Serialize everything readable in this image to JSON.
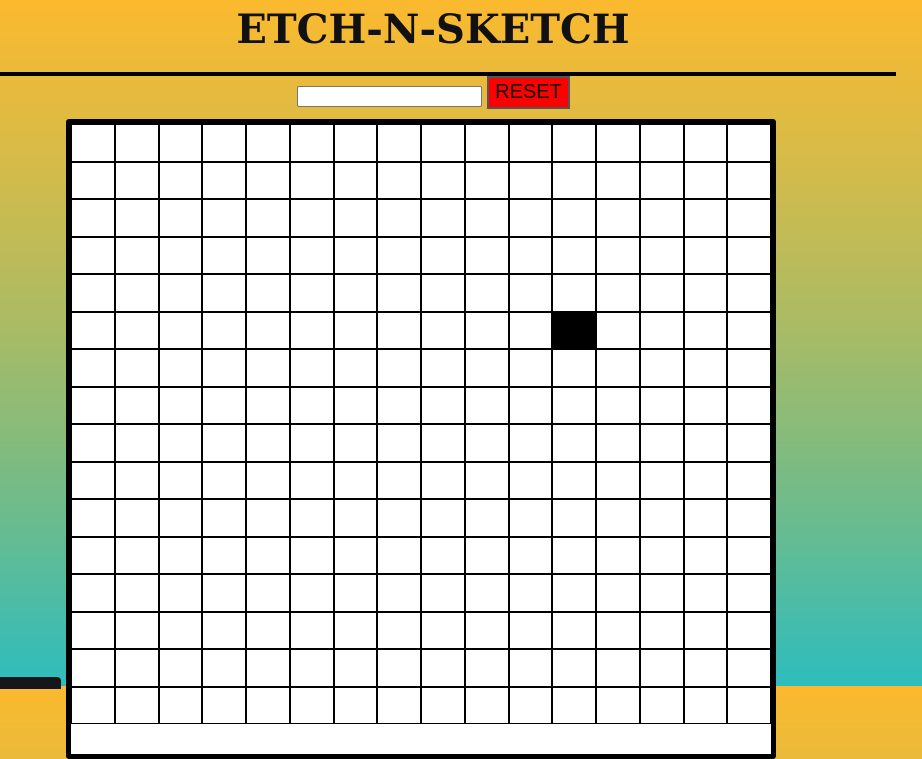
{
  "header": {
    "title": "ETCH-N-SKETCH"
  },
  "controls": {
    "size_input_value": "",
    "reset_label": "RESET",
    "reset_color": "#ff0000"
  },
  "board": {
    "columns": 16,
    "rows": 16,
    "ink_color": "#000000",
    "painted_cells": [
      {
        "row": 5,
        "col": 11
      }
    ]
  }
}
